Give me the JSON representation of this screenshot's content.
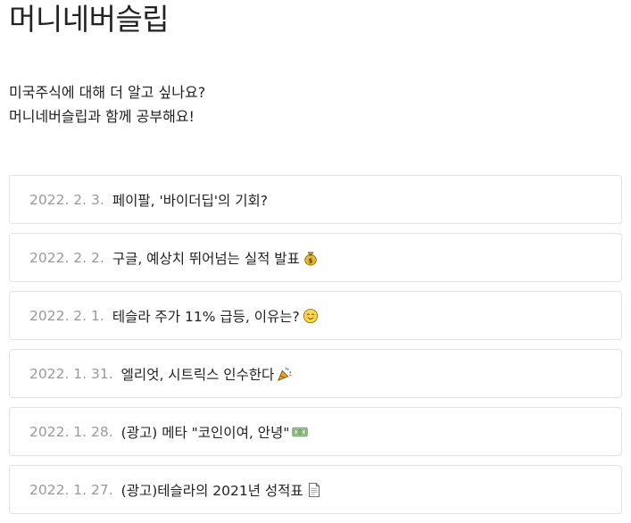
{
  "blog": {
    "title": "머니네버슬립",
    "description_lines": [
      "미국주식에 대해 더 알고 싶나요?",
      "머니네버슬립과 함께 공부해요!"
    ]
  },
  "posts": [
    {
      "date": "2022. 2. 3.",
      "title": "페이팔, '바이더딥'의 기회?",
      "emoji": ""
    },
    {
      "date": "2022. 2. 2.",
      "title": "구글, 예상치 뛰어넘는 실적 발표",
      "emoji": "money-bag-icon"
    },
    {
      "date": "2022. 2. 1.",
      "title": "테슬라 주가 11% 급등, 이유는?",
      "emoji": "relieved-face-icon"
    },
    {
      "date": "2022. 1. 31.",
      "title": "엘리엇, 시트릭스 인수한다",
      "emoji": "party-popper-icon"
    },
    {
      "date": "2022. 1. 28.",
      "title": "(광고) 메타 \"코인이여, 안녕\"",
      "emoji": "dollar-banknote-icon"
    },
    {
      "date": "2022. 1. 27.",
      "title": "(광고)테슬라의 2021년 성적표",
      "emoji": "page-facing-up-icon"
    }
  ]
}
